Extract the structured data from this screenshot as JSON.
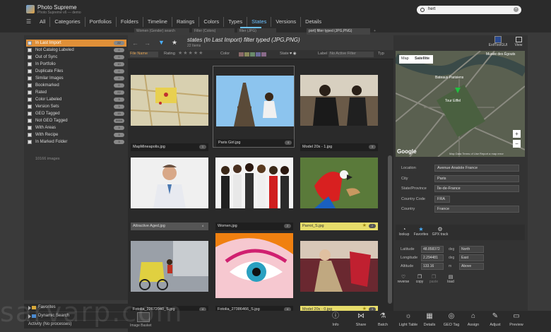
{
  "app": {
    "name": "Photo Supreme",
    "subtitle": "Photo Supreme v6 — demo"
  },
  "search": {
    "value": "hert"
  },
  "tabs": [
    {
      "label": "All"
    },
    {
      "label": "Categories"
    },
    {
      "label": "Portfolios"
    },
    {
      "label": "Folders"
    },
    {
      "label": "Timeline"
    },
    {
      "label": "Ratings"
    },
    {
      "label": "Colors"
    },
    {
      "label": "Types"
    },
    {
      "label": "States"
    },
    {
      "label": "Versions"
    },
    {
      "label": "Details"
    }
  ],
  "doc_tabs": [
    "Women (Gender) search",
    "Filter (Colors)",
    "filter (JPG)",
    "port) filter typed (JPG,PNG)"
  ],
  "library": [
    {
      "label": "In Last Import",
      "count": "22"
    },
    {
      "label": "Not Catalog Labeled",
      "count": "0"
    },
    {
      "label": "Out of Sync",
      "count": "0"
    },
    {
      "label": "In Portfolio",
      "count": "10"
    },
    {
      "label": "Duplicate Files",
      "count": "0"
    },
    {
      "label": "Similar Images",
      "count": "0"
    },
    {
      "label": "Bookmarked",
      "count": "0"
    },
    {
      "label": "Rated",
      "count": "22"
    },
    {
      "label": "Color Labeled",
      "count": "3"
    },
    {
      "label": "Version Sets",
      "count": "3"
    },
    {
      "label": "GEO Tagged",
      "count": "15"
    },
    {
      "label": "Not GEO Tagged",
      "count": "9959"
    },
    {
      "label": "With Areas",
      "count": "3"
    },
    {
      "label": "With Recipe",
      "count": "3"
    },
    {
      "label": "In Marked Folder",
      "count": "3"
    }
  ],
  "image_count": "10166 images",
  "bottom_panels": [
    {
      "label": "Favorites"
    },
    {
      "label": "Dynamic Search"
    },
    {
      "label": "Activity (No processes)"
    }
  ],
  "view": {
    "title": "states (In Last Import) filter typed (JPG,PNG)",
    "subtitle": "22 Items"
  },
  "filterbar": {
    "rating_label": "Rating",
    "color_label": "Color",
    "state_label": "State",
    "label_label": "Label",
    "label_value": "No Active Filter",
    "type_label": "Typ",
    "sort_value": "File Name"
  },
  "thumbs": [
    {
      "name": "MapMineapolis.jpg",
      "rating": "1"
    },
    {
      "name": "Paris Girl.jpg",
      "rating": "4"
    },
    {
      "name": "Model 20s - 1.jpg",
      "rating": "3"
    },
    {
      "name": "Attractive Aged.jpg",
      "rating": "4"
    },
    {
      "name": "Women.jpg",
      "rating": "2"
    },
    {
      "name": "Parrot_S.jpg",
      "rating": "2"
    },
    {
      "name": "Fotolia_22672040_S.jpg",
      "rating": "4"
    },
    {
      "name": "Fotolia_27386466_S.jpg",
      "rating": "4"
    },
    {
      "name": "Model 20s - 0.jpg",
      "rating": "3"
    }
  ],
  "right_top": {
    "exif": "ExifToolGUI",
    "view": "View"
  },
  "map": {
    "tab_map": "Map",
    "tab_satellite": "Satellite",
    "place1": "Bateaux Parisiens",
    "place2": "Tour Eiffel",
    "place3": "Musée des Égouts",
    "footer": "Map Data   Terms of Use   Report a map error",
    "brand": "Google"
  },
  "location": {
    "rows": [
      {
        "label": "Location",
        "value": "Avenue Anatole France"
      },
      {
        "label": "City",
        "value": "Paris"
      },
      {
        "label": "State/Province",
        "value": "Île-de-France"
      },
      {
        "label": "Country Code",
        "value": "FRA"
      },
      {
        "label": "Country",
        "value": "France"
      }
    ]
  },
  "geo_tools": [
    {
      "label": "lookup"
    },
    {
      "label": "Favorites"
    },
    {
      "label": "GPX track"
    }
  ],
  "gps": {
    "lat": {
      "label": "Latitude",
      "value": "48.858372",
      "unit": "deg",
      "dir": "North"
    },
    "lon": {
      "label": "Longitude",
      "value": "2.294481",
      "unit": "deg",
      "dir": "East"
    },
    "alt": {
      "label": "Altitude",
      "value": "133.16",
      "unit": "m",
      "dir": "Above"
    },
    "tools": [
      "reverse",
      "copy",
      "paste",
      "load"
    ]
  },
  "actions": [
    {
      "label": "Info"
    },
    {
      "label": "Share"
    },
    {
      "label": "Batch"
    },
    {
      "label": "Light Table"
    },
    {
      "label": "Details"
    },
    {
      "label": "GEO Tag"
    },
    {
      "label": "Assign"
    },
    {
      "label": "Adjust"
    },
    {
      "label": "Preview"
    }
  ],
  "basket": "Image Basket",
  "watermark": "sarvarp.com",
  "colors": {
    "accent": "#6cc1ff",
    "selected": "#e09038",
    "label_yellow": "#e6dc6a"
  }
}
